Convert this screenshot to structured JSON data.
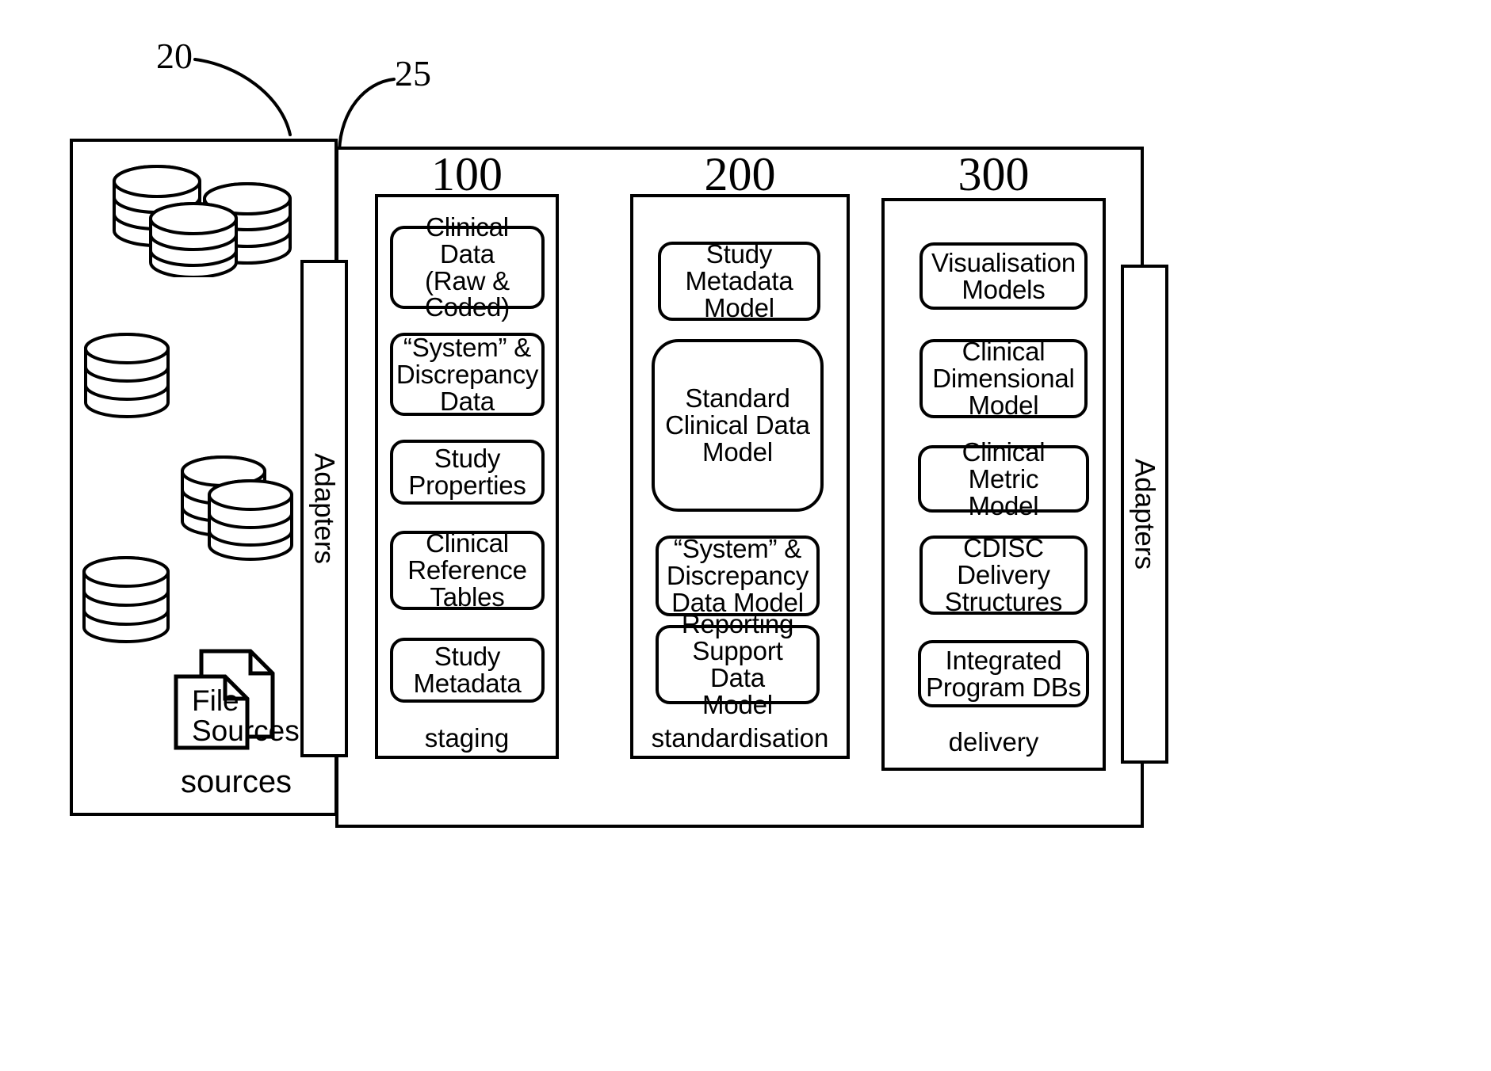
{
  "figure": {
    "ref_numerals": [
      {
        "id": "ref-20",
        "label": "20"
      },
      {
        "id": "ref-25",
        "label": "25"
      }
    ]
  },
  "sources_panel": {
    "caption": "sources",
    "file_sources_label": "File\nSources",
    "database_icons": [
      {
        "name": "db-cluster-top",
        "stacks": 3
      },
      {
        "name": "db-single-upper-left",
        "stacks": 1
      },
      {
        "name": "db-pair-middle",
        "stacks": 2
      },
      {
        "name": "db-single-lower-left",
        "stacks": 1
      }
    ]
  },
  "adapters_left": {
    "label": "Adapters"
  },
  "adapters_right": {
    "label": "Adapters"
  },
  "columns": [
    {
      "number": "100",
      "caption": "staging",
      "items": [
        {
          "label": "Clinical Data\n(Raw &\nCoded)"
        },
        {
          "label": "“System” &\nDiscrepancy\nData"
        },
        {
          "label": "Study\nProperties"
        },
        {
          "label": "Clinical\nReference\nTables"
        },
        {
          "label": "Study\nMetadata"
        }
      ]
    },
    {
      "number": "200",
      "caption": "standardisation",
      "items": [
        {
          "label": "Study\nMetadata\nModel"
        },
        {
          "label": "Standard\nClinical Data\nModel"
        },
        {
          "label": "“System” &\nDiscrepancy\nData Model"
        },
        {
          "label": "Reporting\nSupport Data\nModel"
        }
      ]
    },
    {
      "number": "300",
      "caption": "delivery",
      "items": [
        {
          "label": "Visualisation\nModels"
        },
        {
          "label": "Clinical\nDimensional\nModel"
        },
        {
          "label": "Clinical Metric\nModel"
        },
        {
          "label": "CDISC\nDelivery\nStructures"
        },
        {
          "label": "Integrated\nProgram DBs"
        }
      ]
    }
  ],
  "colors": {
    "stroke": "#000000",
    "background": "#ffffff"
  }
}
